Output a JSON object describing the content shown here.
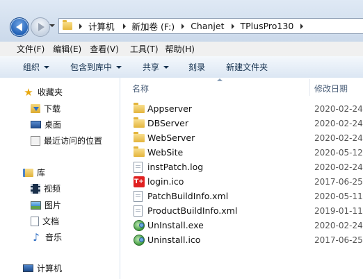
{
  "breadcrumb": [
    "计算机",
    "新加卷 (F:)",
    "Chanjet",
    "TPlusPro130"
  ],
  "menu": [
    "文件(F)",
    "编辑(E)",
    "查看(V)",
    "工具(T)",
    "帮助(H)"
  ],
  "toolbar": {
    "organize": "组织",
    "include_library": "包含到库中",
    "share": "共享",
    "burn": "刻录",
    "new_folder": "新建文件夹"
  },
  "nav": {
    "favorites": "收藏夹",
    "downloads": "下载",
    "desktop": "桌面",
    "recent": "最近访问的位置",
    "libraries": "库",
    "videos": "视频",
    "pictures": "图片",
    "documents": "文档",
    "music": "音乐",
    "computer": "计算机"
  },
  "columns": {
    "name": "名称",
    "date": "修改日期"
  },
  "files": [
    {
      "name": "Appserver",
      "date": "2020-02-24",
      "icon": "folder-icon"
    },
    {
      "name": "DBServer",
      "date": "2020-02-24",
      "icon": "folder-icon"
    },
    {
      "name": "WebServer",
      "date": "2020-02-24",
      "icon": "folder-icon"
    },
    {
      "name": "WebSite",
      "date": "2020-05-12",
      "icon": "folder-icon"
    },
    {
      "name": "instPatch.log",
      "date": "2020-02-24",
      "icon": "text-file-icon"
    },
    {
      "name": "login.ico",
      "date": "2017-06-25",
      "icon": "tplus-logo-icon",
      "icon_text": "T+"
    },
    {
      "name": "PatchBuildInfo.xml",
      "date": "2020-05-11",
      "icon": "xml-file-icon"
    },
    {
      "name": "ProductBuildInfo.xml",
      "date": "2019-01-11",
      "icon": "xml-file-icon"
    },
    {
      "name": "UnInstall.exe",
      "date": "2020-02-24",
      "icon": "uninstall-exe-icon"
    },
    {
      "name": "Uninstall.ico",
      "date": "2017-06-25",
      "icon": "uninstall-ico-icon"
    }
  ]
}
